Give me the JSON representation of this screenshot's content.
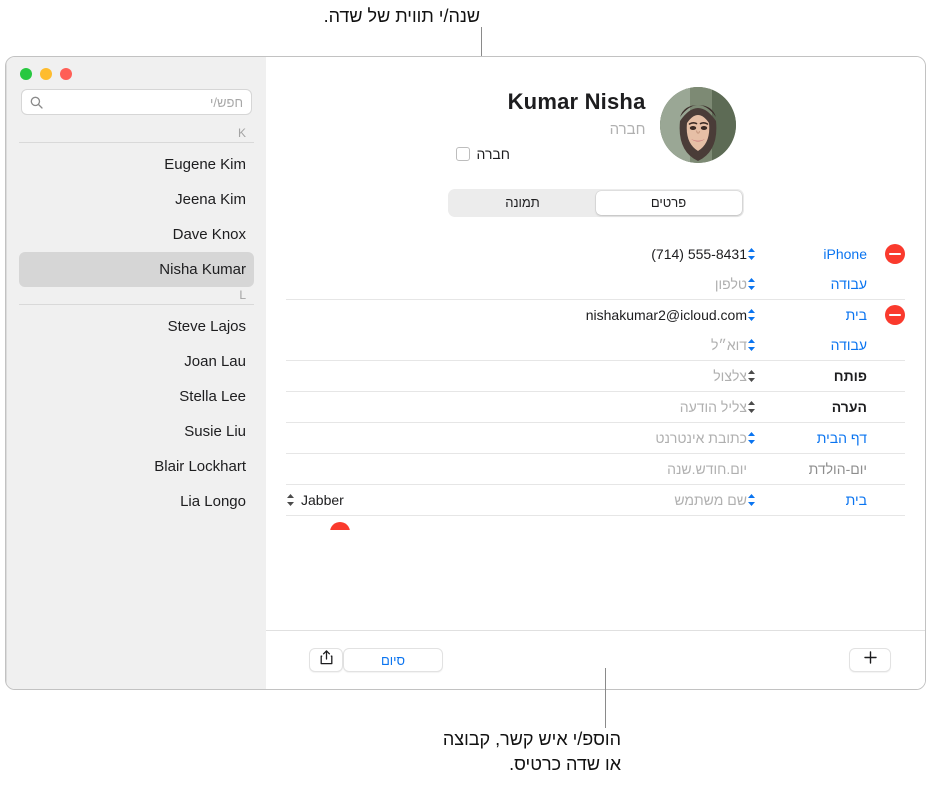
{
  "callouts": {
    "top": "שנה/י תווית של שדה.",
    "bottom": "הוספ/י איש קשר, קבוצה\nאו שדה כרטיס."
  },
  "window": {
    "traffic_lights": [
      {
        "name": "close-button",
        "color": "#ff5f57"
      },
      {
        "name": "minimize-button",
        "color": "#febc2e"
      },
      {
        "name": "zoom-button",
        "color": "#28c840"
      }
    ]
  },
  "sidebar": {
    "search": {
      "placeholder": "חפש/י",
      "icon": "search-icon",
      "value": ""
    },
    "sections": [
      {
        "letter": "K",
        "contacts": [
          {
            "name": "Eugene Kim",
            "selected": false
          },
          {
            "name": "Jeena Kim",
            "selected": false
          },
          {
            "name": "Dave Knox",
            "selected": false
          },
          {
            "name": "Nisha Kumar",
            "selected": true
          }
        ]
      },
      {
        "letter": "L",
        "contacts": [
          {
            "name": "Steve Lajos",
            "selected": false
          },
          {
            "name": "Joan Lau",
            "selected": false
          },
          {
            "name": "Stella Lee",
            "selected": false
          },
          {
            "name": "Susie Liu",
            "selected": false
          },
          {
            "name": "Blair Lockhart",
            "selected": false
          },
          {
            "name": "Lia Longo",
            "selected": false
          }
        ]
      }
    ]
  },
  "detail": {
    "fullname": "Kumar  Nisha",
    "company_placeholder": "חברה",
    "company_checkbox_label": "חברה",
    "avatar": "contact-photo",
    "tabs": [
      {
        "label": "תמונה",
        "active": false
      },
      {
        "label": "פרטים",
        "active": true
      }
    ],
    "fields": [
      {
        "id": "phone",
        "deletable": true,
        "label": "iPhone",
        "label_style": "blue",
        "value": "(714) 555-8431",
        "value_style": "value",
        "sub_label": "עבודה",
        "sub_label_style": "blue",
        "sub_value": "טלפון",
        "sub_value_style": "placeholder"
      },
      {
        "id": "email",
        "deletable": true,
        "label": "בית",
        "label_style": "blue",
        "value": "nishakumar2@icloud.com",
        "value_style": "value",
        "sub_label": "עבודה",
        "sub_label_style": "blue",
        "sub_value": "דוא״ל",
        "sub_value_style": "placeholder"
      },
      {
        "id": "ringtone",
        "deletable": false,
        "label": "פותח",
        "label_style": "dark",
        "value": "צלצול",
        "value_style": "placeholder"
      },
      {
        "id": "text-tone",
        "deletable": false,
        "label": "הערה",
        "label_style": "dark",
        "value": "צליל הודעה",
        "value_style": "placeholder"
      },
      {
        "id": "homepage",
        "deletable": false,
        "label": "דף הבית",
        "label_style": "blue",
        "value": "כתובת אינטרנט",
        "value_style": "placeholder"
      },
      {
        "id": "birthday",
        "deletable": false,
        "label": "יום-הולדת",
        "label_style": "plain",
        "value": "יום.חודש.שנה",
        "value_style": "placeholder"
      },
      {
        "id": "instant-message",
        "deletable": false,
        "label": "בית",
        "label_style": "blue",
        "sub_value": "שם משתמש",
        "service": "Jabber"
      }
    ]
  },
  "toolbar": {
    "share_icon": "share-icon",
    "done_label": "סיום",
    "add_icon": "plus-icon"
  }
}
